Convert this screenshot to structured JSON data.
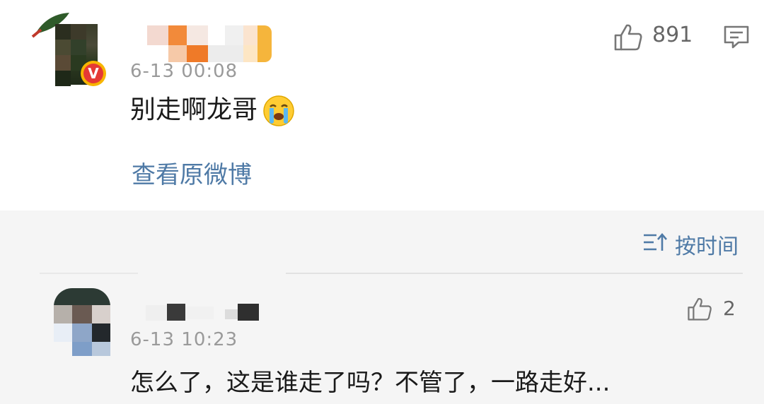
{
  "main_comment": {
    "time": "6-13 00:08",
    "text": "别走啊龙哥",
    "emoji_icon": "crying-face-icon",
    "view_original": "查看原微博",
    "like_count": "891",
    "verified_badge": "V"
  },
  "replies_header": {
    "sort_label": "按时间"
  },
  "reply": {
    "time": "6-13 10:23",
    "text": "怎么了，这是谁走了吗？不管了，一路走好...",
    "like_count": "2"
  },
  "colors": {
    "link": "#4f7aa6",
    "badge_ring": "#f7b500",
    "badge_fill": "#e53935",
    "reply_bg": "#f5f5f5"
  }
}
